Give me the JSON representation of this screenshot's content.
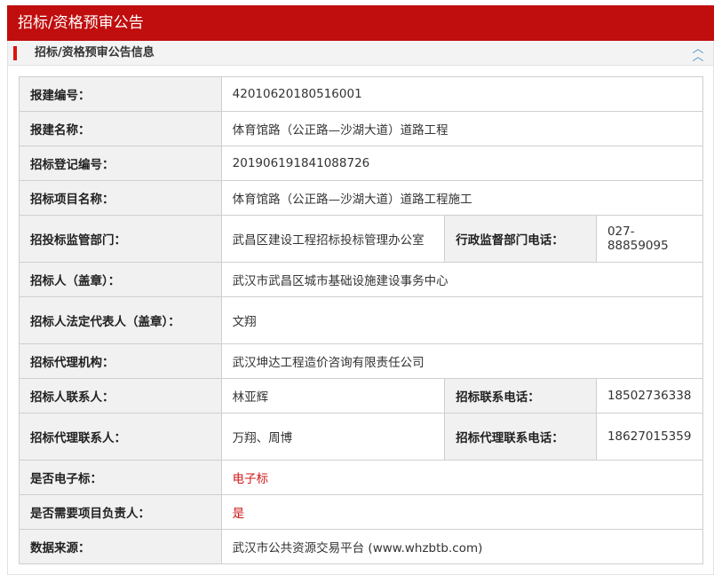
{
  "page": {
    "title": "招标/资格预审公告"
  },
  "section": {
    "title": "招标/资格预审公告信息"
  },
  "rows": {
    "project_no": {
      "label": "报建编号：",
      "value": "42010620180516001"
    },
    "project_name": {
      "label": "报建名称：",
      "value": "体育馆路（公正路—沙湖大道）道路工程"
    },
    "tender_reg_no": {
      "label": "招标登记编号：",
      "value": "201906191841088726"
    },
    "tender_project_name": {
      "label": "招标项目名称：",
      "value": "体育馆路（公正路—沙湖大道）道路工程施工"
    },
    "supervision_dept": {
      "label": "招投标监管部门：",
      "value": "武昌区建设工程招标投标管理办公室"
    },
    "admin_phone": {
      "label": "行政监督部门电话：",
      "value": "027-88859095"
    },
    "tenderer": {
      "label": "招标人（盖章）：",
      "value": "武汉市武昌区城市基础设施建设事务中心"
    },
    "legal_rep": {
      "label": "招标人法定代表人（盖章）：",
      "value": "文翔"
    },
    "agency": {
      "label": "招标代理机构：",
      "value": "武汉坤达工程造价咨询有限责任公司"
    },
    "tenderer_contact": {
      "label": "招标人联系人：",
      "value": "林亚辉"
    },
    "tender_phone": {
      "label": "招标联系电话：",
      "value": "18502736338"
    },
    "agency_contact": {
      "label": "招标代理联系人：",
      "value": "万翔、周博"
    },
    "agency_phone": {
      "label": "招标代理联系电话：",
      "value": "18627015359"
    },
    "electronic": {
      "label": "是否电子标：",
      "value": "电子标"
    },
    "need_manager": {
      "label": "是否需要项目负责人：",
      "value": "是"
    },
    "source": {
      "label": "数据来源：",
      "value": "武汉市公共资源交易平台 (www.whzbtb.com)"
    }
  },
  "colors": {
    "brand_red": "#c00d0d",
    "value_red": "#d01818",
    "label_bg": "#f1f1f1"
  },
  "icons": {
    "collapse": "double-chevron-up-icon"
  }
}
